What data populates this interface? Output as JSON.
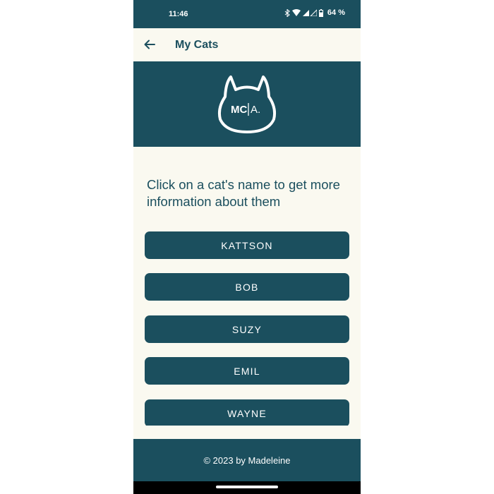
{
  "status_bar": {
    "time": "11:46",
    "battery": "64 %",
    "icons": [
      "bluetooth-icon",
      "wifi-icon",
      "signal-icon",
      "battery-icon"
    ]
  },
  "app_bar": {
    "back_icon": "arrow-left-icon",
    "title": "My Cats"
  },
  "logo": {
    "text_left": "MC",
    "text_right": "A.",
    "icon": "cat-head-icon"
  },
  "intro": {
    "text": "Click on a cat's name to get more information about them"
  },
  "cats": [
    {
      "label": "KATTSON"
    },
    {
      "label": "BOB"
    },
    {
      "label": "SUZY"
    },
    {
      "label": "EMIL"
    },
    {
      "label": "WAYNE"
    }
  ],
  "footer": {
    "text": "© 2023 by Madeleine"
  },
  "colors": {
    "primary": "#1b4f5e",
    "background": "#faf9f0",
    "on_primary": "#ffffff"
  }
}
